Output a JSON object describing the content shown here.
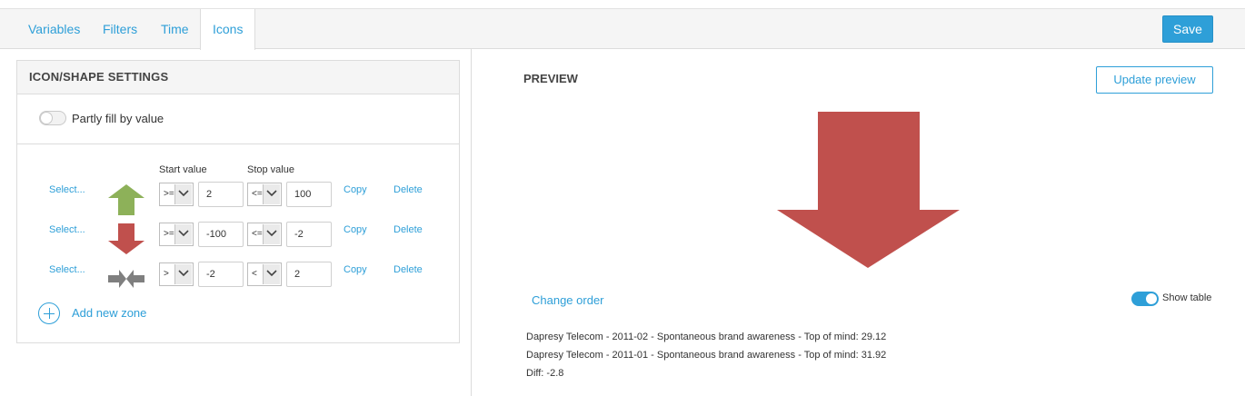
{
  "tabs": [
    {
      "label": "Variables"
    },
    {
      "label": "Filters"
    },
    {
      "label": "Time"
    },
    {
      "label": "Icons"
    }
  ],
  "toolbar": {
    "save_label": "Save"
  },
  "settings": {
    "title": "ICON/SHAPE SETTINGS",
    "partly_fill_label": "Partly fill by value",
    "partly_fill_on": false,
    "start_header": "Start value",
    "stop_header": "Stop value",
    "zones": [
      {
        "select_label": "Select...",
        "icon": "arrow-up-icon",
        "color": "#8db159",
        "start_op": ">=",
        "start_value": "2",
        "stop_op": "<=",
        "stop_value": "100",
        "copy_label": "Copy",
        "delete_label": "Delete"
      },
      {
        "select_label": "Select...",
        "icon": "arrow-down-icon",
        "color": "#c0504d",
        "start_op": ">=",
        "start_value": "-100",
        "stop_op": "<=",
        "stop_value": "-2",
        "copy_label": "Copy",
        "delete_label": "Delete"
      },
      {
        "select_label": "Select...",
        "icon": "arrows-converge-icon",
        "color": "#7f7f7f",
        "start_op": ">",
        "start_value": "-2",
        "stop_op": "<",
        "stop_value": "2",
        "copy_label": "Copy",
        "delete_label": "Delete"
      }
    ],
    "add_zone_label": "Add new zone"
  },
  "preview": {
    "title": "PREVIEW",
    "update_label": "Update preview",
    "icon": "big-arrow-down-icon",
    "icon_color": "#c0504d",
    "change_order_label": "Change order",
    "show_table_label": "Show table",
    "show_table_on": true,
    "lines": [
      "Dapresy Telecom - 2011-02 - Spontaneous brand awareness - Top of mind: 29.12",
      "Dapresy Telecom - 2011-01 - Spontaneous brand awareness - Top of mind: 31.92",
      "Diff: -2.8"
    ]
  }
}
